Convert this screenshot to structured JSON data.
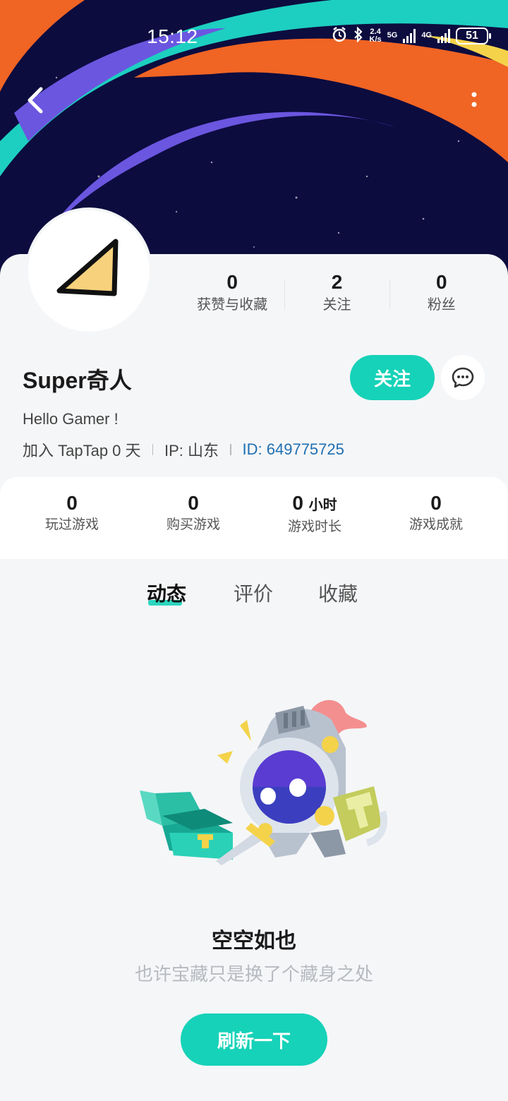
{
  "status_bar": {
    "time": "15:12",
    "speed_value": "2.4",
    "speed_unit": "K/s",
    "network_5g": "5G",
    "network_4g": "4G",
    "battery": "51"
  },
  "profile": {
    "name": "Super奇人",
    "bio": "Hello Gamer !",
    "joined": "加入 TapTap 0 天",
    "ip": "IP:  山东",
    "id": "ID:  649775725",
    "follow_label": "关注"
  },
  "social_stats": [
    {
      "value": "0",
      "label": "获赞与收藏"
    },
    {
      "value": "2",
      "label": "关注"
    },
    {
      "value": "0",
      "label": "粉丝"
    }
  ],
  "game_stats": [
    {
      "value": "0",
      "unit": "",
      "label": "玩过游戏"
    },
    {
      "value": "0",
      "unit": "",
      "label": "购买游戏"
    },
    {
      "value": "0",
      "unit": "小时",
      "label": "游戏时长"
    },
    {
      "value": "0",
      "unit": "",
      "label": "游戏成就"
    }
  ],
  "tabs": [
    {
      "label": "动态",
      "active": true
    },
    {
      "label": "评价",
      "active": false
    },
    {
      "label": "收藏",
      "active": false
    }
  ],
  "empty_state": {
    "title": "空空如也",
    "subtitle": "也许宝藏只是换了个藏身之处",
    "button": "刷新一下"
  },
  "colors": {
    "accent": "#16d2b8",
    "banner_bg": "#0c0c3f",
    "id_link": "#1f6fb0"
  }
}
